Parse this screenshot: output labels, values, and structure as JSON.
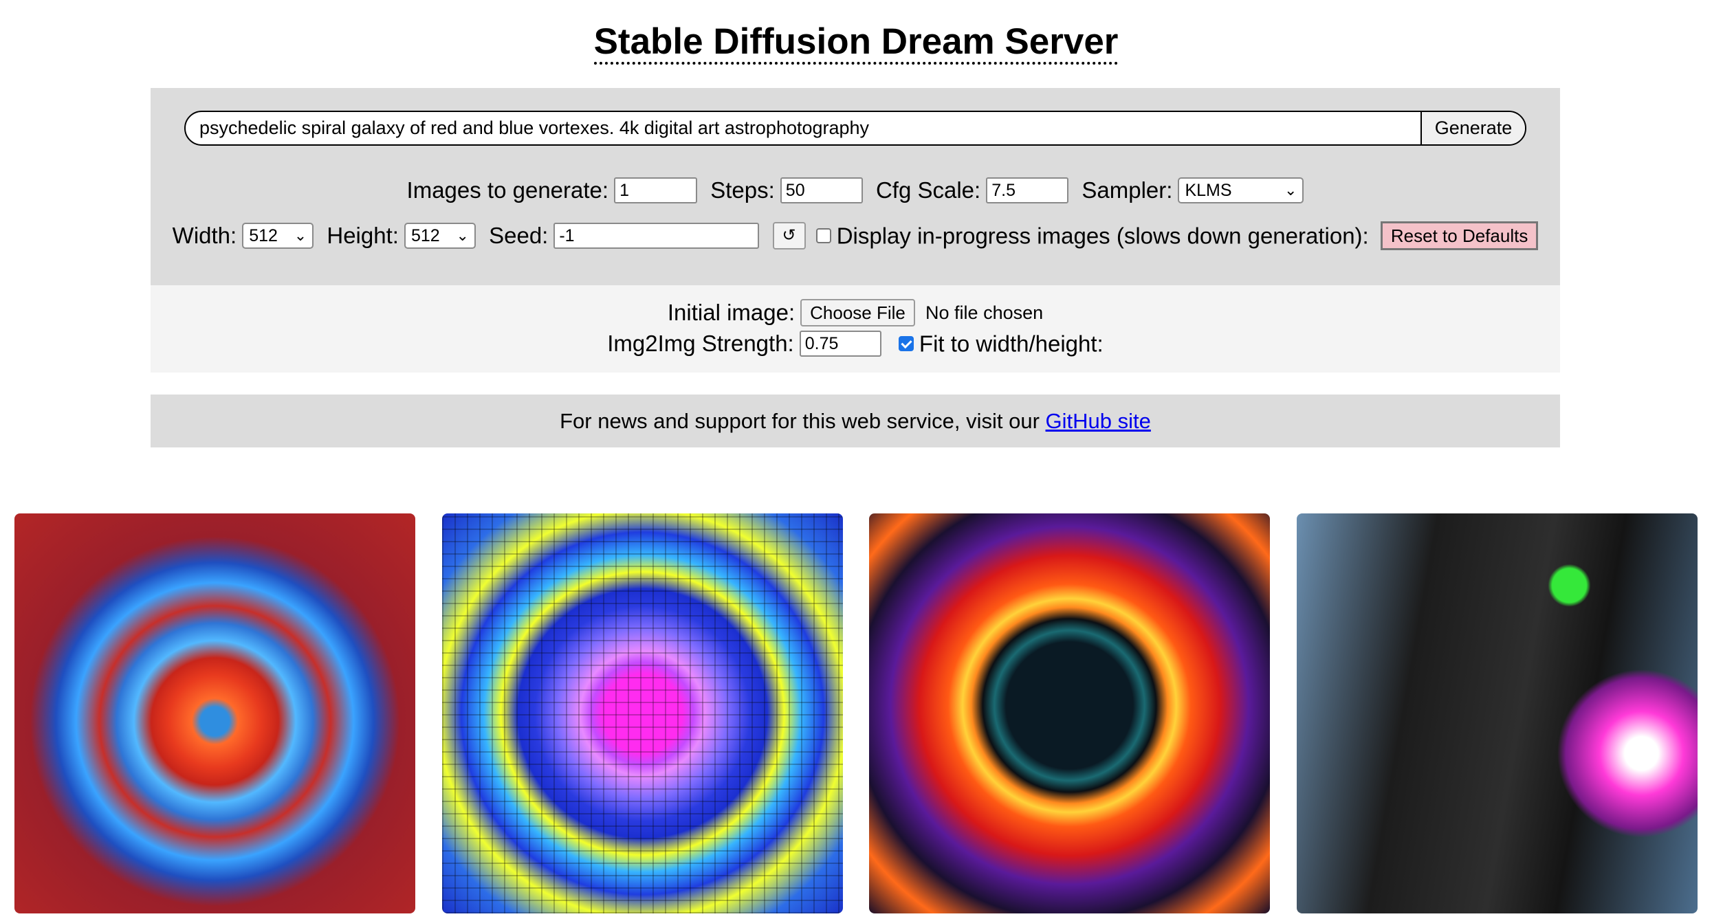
{
  "page": {
    "title": "Stable Diffusion Dream Server"
  },
  "prompt": {
    "value": "psychedelic spiral galaxy of red and blue vortexes. 4k digital art astrophotography",
    "generate_label": "Generate"
  },
  "options": {
    "images_label": "Images to generate:",
    "images_value": "1",
    "steps_label": "Steps:",
    "steps_value": "50",
    "cfg_label": "Cfg Scale:",
    "cfg_value": "7.5",
    "sampler_label": "Sampler:",
    "sampler_value": "KLMS",
    "width_label": "Width:",
    "width_value": "512",
    "height_label": "Height:",
    "height_value": "512",
    "seed_label": "Seed:",
    "seed_value": "-1",
    "seed_reset_glyph": "↺",
    "progress_label": "Display in-progress images (slows down generation):",
    "progress_checked": false,
    "reset_label": "Reset to Defaults"
  },
  "img2img": {
    "initial_label": "Initial image:",
    "choose_label": "Choose File",
    "no_file": "No file chosen",
    "strength_label": "Img2Img Strength:",
    "strength_value": "0.75",
    "fit_label": "Fit to width/height:",
    "fit_checked": true
  },
  "news": {
    "text": "For news and support for this web service, visit our",
    "link": "GitHub site"
  },
  "colors": {
    "panel_gray": "#dcdcdc",
    "panel_light": "#f4f4f4",
    "reset_pink": "#f4c2c9",
    "link_blue": "#0000ee",
    "checkbox_blue": "#1a73e8"
  }
}
